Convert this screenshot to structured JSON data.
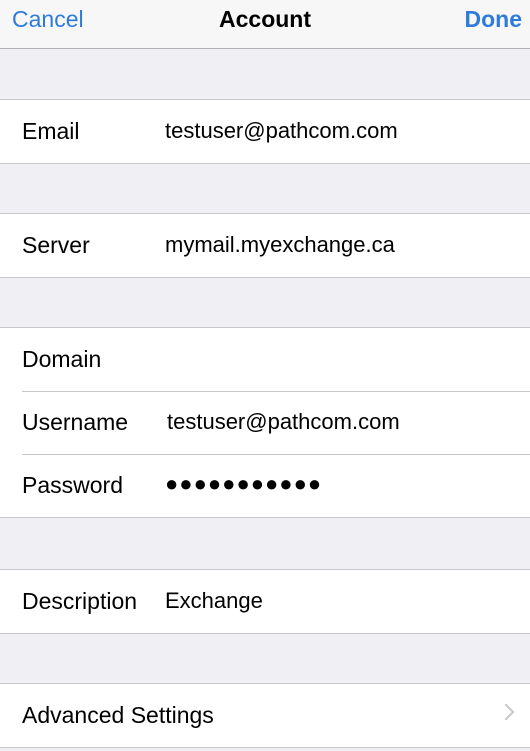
{
  "navbar": {
    "cancel_label": "Cancel",
    "title": "Account",
    "done_label": "Done"
  },
  "fields": {
    "email": {
      "label": "Email",
      "value": "testuser@pathcom.com"
    },
    "server": {
      "label": "Server",
      "value": "mymail.myexchange.ca"
    },
    "domain": {
      "label": "Domain",
      "value": ""
    },
    "username": {
      "label": "Username",
      "value": "testuser@pathcom.com"
    },
    "password": {
      "label": "Password",
      "value": "●●●●●●●●●●●"
    },
    "description": {
      "label": "Description",
      "value": "Exchange"
    }
  },
  "advanced": {
    "label": "Advanced Settings"
  },
  "colors": {
    "accent": "#2f7bd9",
    "background": "#efeff4",
    "separator": "#c8c7cc"
  }
}
